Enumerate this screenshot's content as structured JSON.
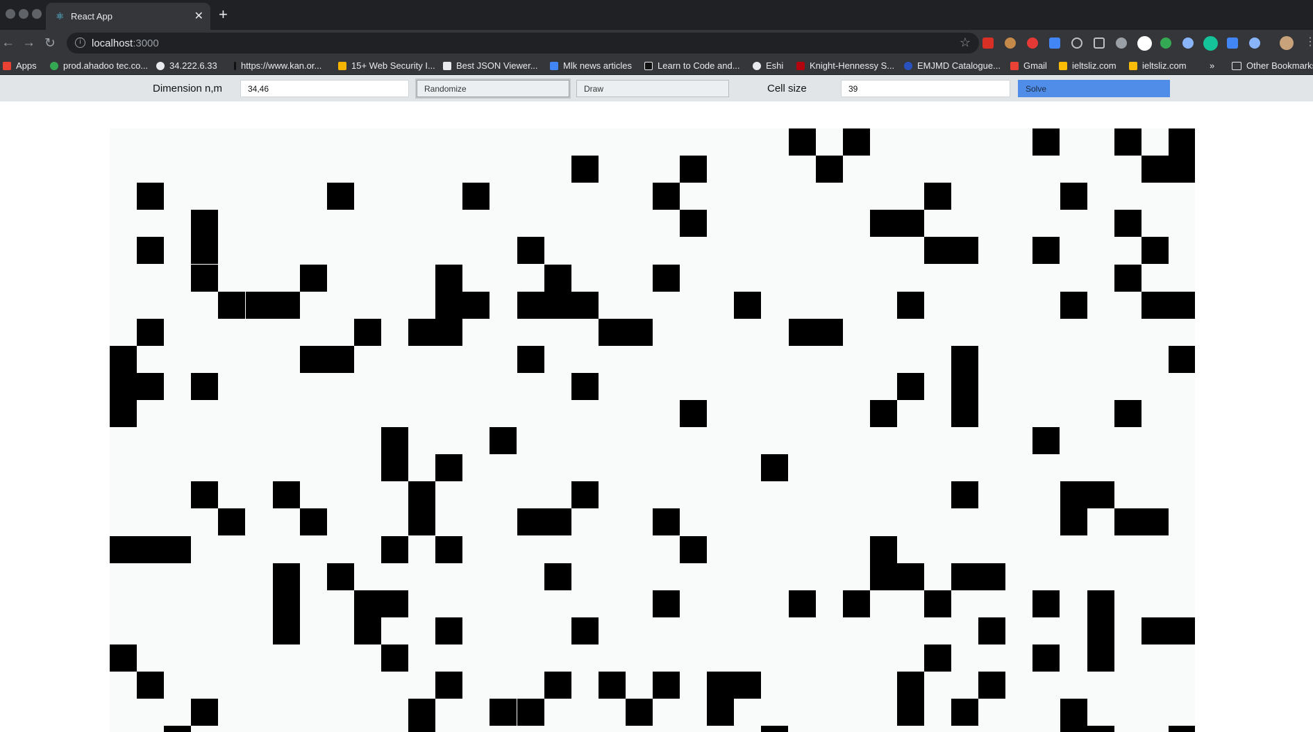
{
  "browser": {
    "tab_title": "React App",
    "tab_favicon": "react-icon",
    "new_tab_label": "+",
    "url_host": "localhost",
    "url_port": ":3000",
    "bookmarks": [
      {
        "label": "Apps",
        "color": "#e94235"
      },
      {
        "label": "prod.ahadoo tec.co...",
        "color": "#34a853"
      },
      {
        "label": "34.222.6.33",
        "color": "#e8eaed"
      },
      {
        "label": "https://www.kan.or...",
        "color": "#111111"
      },
      {
        "label": "15+ Web Security I...",
        "color": "#f4b400"
      },
      {
        "label": "Best JSON Viewer...",
        "color": "#e8eaed"
      },
      {
        "label": "Mlk news articles",
        "color": "#4285f4"
      },
      {
        "label": "Learn to Code and...",
        "color": "#111111"
      },
      {
        "label": "Eshi",
        "color": "#e8eaed"
      },
      {
        "label": "Knight-Hennessy S...",
        "color": "#b1040e"
      },
      {
        "label": "EMJMD Catalogue...",
        "color": "#2a52be"
      },
      {
        "label": "Gmail",
        "color": "#ea4335"
      },
      {
        "label": "ieltsliz.com",
        "color": "#fbbc05"
      },
      {
        "label": "ieltsliz.com",
        "color": "#fbbc05"
      }
    ],
    "more_bookmarks": "»",
    "other_bookmarks": "Other Bookmarks"
  },
  "controls": {
    "dimension_label": "Dimension n,m",
    "dimension_value": "34,46",
    "randomize_label": "Randomize",
    "draw_label": "Draw",
    "cell_size_label": "Cell size",
    "cell_size_value": "39",
    "solve_label": "Solve"
  },
  "grid": {
    "cell_size": 39,
    "filled_cells": [
      [
        0,
        25
      ],
      [
        0,
        27
      ],
      [
        0,
        34
      ],
      [
        0,
        37
      ],
      [
        0,
        39
      ],
      [
        1,
        17
      ],
      [
        1,
        21
      ],
      [
        1,
        26
      ],
      [
        1,
        38
      ],
      [
        1,
        39
      ],
      [
        2,
        1
      ],
      [
        2,
        8
      ],
      [
        2,
        13
      ],
      [
        2,
        20
      ],
      [
        2,
        30
      ],
      [
        2,
        35
      ],
      [
        3,
        3
      ],
      [
        3,
        21
      ],
      [
        3,
        28
      ],
      [
        3,
        29
      ],
      [
        3,
        37
      ],
      [
        4,
        1
      ],
      [
        4,
        3
      ],
      [
        4,
        15
      ],
      [
        4,
        30
      ],
      [
        4,
        31
      ],
      [
        4,
        34
      ],
      [
        4,
        38
      ],
      [
        5,
        3
      ],
      [
        5,
        7
      ],
      [
        5,
        12
      ],
      [
        5,
        16
      ],
      [
        5,
        20
      ],
      [
        5,
        37
      ],
      [
        6,
        4
      ],
      [
        6,
        5
      ],
      [
        6,
        6
      ],
      [
        6,
        12
      ],
      [
        6,
        13
      ],
      [
        6,
        15
      ],
      [
        6,
        16
      ],
      [
        6,
        17
      ],
      [
        6,
        23
      ],
      [
        6,
        29
      ],
      [
        6,
        35
      ],
      [
        6,
        38
      ],
      [
        6,
        39
      ],
      [
        7,
        1
      ],
      [
        7,
        9
      ],
      [
        7,
        11
      ],
      [
        7,
        12
      ],
      [
        7,
        18
      ],
      [
        7,
        19
      ],
      [
        7,
        25
      ],
      [
        7,
        26
      ],
      [
        8,
        0
      ],
      [
        8,
        7
      ],
      [
        8,
        8
      ],
      [
        8,
        15
      ],
      [
        8,
        31
      ],
      [
        8,
        39
      ],
      [
        9,
        0
      ],
      [
        9,
        1
      ],
      [
        9,
        3
      ],
      [
        9,
        17
      ],
      [
        9,
        29
      ],
      [
        9,
        31
      ],
      [
        10,
        0
      ],
      [
        10,
        21
      ],
      [
        10,
        28
      ],
      [
        10,
        31
      ],
      [
        10,
        37
      ],
      [
        11,
        10
      ],
      [
        11,
        14
      ],
      [
        11,
        34
      ],
      [
        12,
        10
      ],
      [
        12,
        12
      ],
      [
        12,
        24
      ],
      [
        13,
        3
      ],
      [
        13,
        6
      ],
      [
        13,
        11
      ],
      [
        13,
        17
      ],
      [
        13,
        31
      ],
      [
        13,
        35
      ],
      [
        13,
        36
      ],
      [
        14,
        4
      ],
      [
        14,
        7
      ],
      [
        14,
        11
      ],
      [
        14,
        15
      ],
      [
        14,
        16
      ],
      [
        14,
        20
      ],
      [
        14,
        35
      ],
      [
        14,
        37
      ],
      [
        14,
        38
      ],
      [
        15,
        0
      ],
      [
        15,
        1
      ],
      [
        15,
        2
      ],
      [
        15,
        10
      ],
      [
        15,
        12
      ],
      [
        15,
        21
      ],
      [
        15,
        28
      ],
      [
        16,
        6
      ],
      [
        16,
        8
      ],
      [
        16,
        16
      ],
      [
        16,
        28
      ],
      [
        16,
        29
      ],
      [
        16,
        31
      ],
      [
        16,
        32
      ],
      [
        17,
        6
      ],
      [
        17,
        9
      ],
      [
        17,
        10
      ],
      [
        17,
        20
      ],
      [
        17,
        25
      ],
      [
        17,
        27
      ],
      [
        17,
        30
      ],
      [
        17,
        34
      ],
      [
        17,
        36
      ],
      [
        18,
        6
      ],
      [
        18,
        9
      ],
      [
        18,
        12
      ],
      [
        18,
        17
      ],
      [
        18,
        32
      ],
      [
        18,
        36
      ],
      [
        18,
        38
      ],
      [
        18,
        39
      ],
      [
        19,
        0
      ],
      [
        19,
        10
      ],
      [
        19,
        30
      ],
      [
        19,
        34
      ],
      [
        19,
        36
      ],
      [
        20,
        1
      ],
      [
        20,
        12
      ],
      [
        20,
        16
      ],
      [
        20,
        18
      ],
      [
        20,
        20
      ],
      [
        20,
        22
      ],
      [
        20,
        23
      ],
      [
        20,
        29
      ],
      [
        20,
        32
      ],
      [
        21,
        3
      ],
      [
        21,
        11
      ],
      [
        21,
        14
      ],
      [
        21,
        15
      ],
      [
        21,
        19
      ],
      [
        21,
        22
      ],
      [
        21,
        29
      ],
      [
        21,
        31
      ],
      [
        21,
        35
      ],
      [
        22,
        2
      ],
      [
        22,
        11
      ],
      [
        22,
        24
      ],
      [
        22,
        35
      ],
      [
        22,
        36
      ],
      [
        22,
        39
      ]
    ]
  }
}
